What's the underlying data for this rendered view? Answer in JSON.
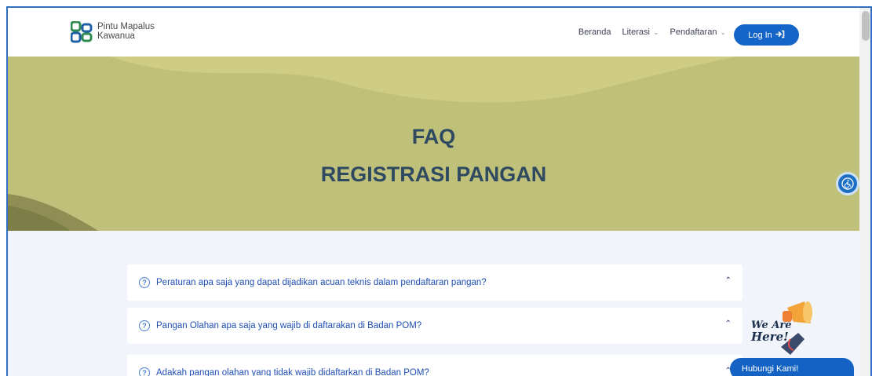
{
  "brand": {
    "line1": "Pintu Mapalus",
    "line2": "Kawanua",
    "color": "#2e8b4e"
  },
  "nav": {
    "items": [
      {
        "label": "Beranda",
        "has_dropdown": false
      },
      {
        "label": "Literasi",
        "has_dropdown": true
      },
      {
        "label": "Pendaftaran",
        "has_dropdown": true
      }
    ],
    "login_label": "Log In",
    "login_icon": "login-icon"
  },
  "hero": {
    "title_line1": "FAQ",
    "title_line2": "REGISTRASI PANGAN",
    "background": "#bfc07a"
  },
  "faq": {
    "items": [
      {
        "question": "Peraturan apa saja yang dapat dijadikan acuan teknis dalam pendaftaran pangan?"
      },
      {
        "question": "Pangan Olahan apa saja yang wajib di daftarakan di Badan POM?"
      },
      {
        "question": "Adakah pangan olahan yang tidak wajib didaftarkan di Badan POM?"
      }
    ]
  },
  "widget": {
    "line1": "We Are",
    "line2": "Here!",
    "contact_label": "Hubungi Kami!"
  },
  "colors": {
    "accent": "#1565c9",
    "title": "#2f4a60",
    "faq_text": "#1f4fb3"
  }
}
